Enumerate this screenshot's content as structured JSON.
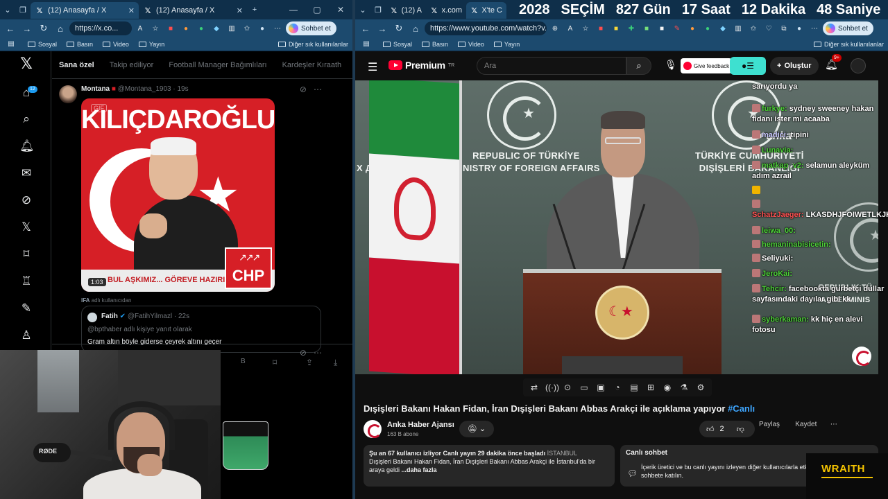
{
  "left_browser": {
    "tabs": [
      {
        "label": "(12) Anasayfa / X",
        "active": true
      },
      {
        "label": "(12) Anasayfa / X",
        "active": false
      }
    ],
    "url": "https://x.co...",
    "sohbet_label": "Sohbet et",
    "bookmarks": [
      "Sosyal",
      "Basın",
      "Video",
      "Yayın"
    ],
    "bookmarks_right": "Diğer sık kullanılanlar"
  },
  "x_app": {
    "notification_count": "12",
    "tabs": [
      "Sana özel",
      "Takip ediliyor",
      "Football Manager Bağımlıları",
      "Kardeşler Kıraath"
    ],
    "post": {
      "author": "Montana",
      "handle": "@Montana_1903",
      "time": "19s",
      "poster_title": "KILIÇDAROĞLU",
      "poster_slogan": "BUL AŞKIMIZ... GÖREVE HAZIRIZ!",
      "poster_party": "CHP",
      "media_tag": "GIF",
      "video_duration": "1:03",
      "caption_prefix": "IFA",
      "caption_suffix": "adlı kullanıcıdan"
    },
    "quote": {
      "author": "Fatih",
      "handle": "@FatihYilmazl",
      "time": "22s",
      "reply_to": "@bpthaber adlı kişiye yanıt olarak",
      "text": "Gram altın böyle giderse çeyrek altını geçer"
    },
    "actions_count": "B"
  },
  "webcam": {
    "mic_brand": "RØDE"
  },
  "right_browser": {
    "tabs": [
      {
        "label": "(12) A",
        "active": false
      },
      {
        "label": "x.com",
        "active": false
      },
      {
        "label": "X'te C",
        "active": true
      }
    ],
    "countdown": [
      "2028",
      "SEÇİM",
      "827 Gün",
      "17 Saat",
      "12 Dakika",
      "48 Saniye"
    ],
    "url": "https://www.youtube.com/watch?v...",
    "sohbet_label": "Sohbet et",
    "bookmarks": [
      "Sosyal",
      "Basın",
      "Video",
      "Yayın"
    ],
    "bookmarks_right": "Diğer sık kullanılanlar"
  },
  "youtube": {
    "logo": "Premium",
    "logo_region": "TR",
    "search_placeholder": "Ara",
    "feedback_label": "Give feedback",
    "create_label": "Oluştur",
    "notification_count": "9+",
    "wall_left": [
      "REPUBLIC OF TÜRKİYE",
      "MINISTRY OF FOREIGN AFFAIRS"
    ],
    "wall_right": [
      "TÜRKİYE CUMHURİYETİ",
      "DIŞİŞLERİ BAKANLIĞI"
    ],
    "wall_left_partial": "Х ДЕЛ",
    "wall_far_right": [
      "REPUBLIK TÜ",
      "AUßENMINIS"
    ],
    "watermark": "anka",
    "title": "Dışişleri Bakanı Hakan Fidan, İran Dışişleri Bakanı Abbas Arakçi ile açıklama yapıyor",
    "title_tag": "#Canlı",
    "channel": "Anka Haber Ajansı",
    "subscribers": "163 B abone",
    "likes": "2",
    "share_label": "Paylaş",
    "save_label": "Kaydet",
    "description": {
      "meta": "Şu an 67 kullanıcı izliyor  Canlı yayın 29 dakika önce başladı",
      "location": "İSTANBUL",
      "text": "Dışişleri Bakanı Hakan Fidan, İran Dışişleri Bakanı Abbas Arakçi ile İstanbul'da bir araya geldi",
      "more": "...daha fazla"
    },
    "live_chat": {
      "heading": "Canlı sohbet",
      "text": "İçerik üretici ve bu canlı yayını izleyen diğer kullanıcılarla etkileşime girmek için sohbete katılın."
    },
    "sponsor": "WRAITH"
  },
  "stream_chat": [
    {
      "user": "",
      "text": "sarıyordu ya",
      "color": "#ffffff"
    },
    {
      "user": "furkye:",
      "text": "sydney sweeney hakan fidanı ister mi acaaba",
      "color": "#4cd137"
    },
    {
      "user": "madici:",
      "text": "tipini",
      "color": "#c9c9ff"
    },
    {
      "user": "Lunavia:",
      "text": "",
      "color": "#4cd137"
    },
    {
      "user": "matkap_v2:",
      "text": "selamun aleyküm adım azrail",
      "color": "#4cd137"
    },
    {
      "user": "",
      "text": "",
      "color": "#ffffff"
    },
    {
      "user": "SchatzJaeger:",
      "text": "LKASDHJFOIWETLKJHLSKDGAS",
      "color": "#ff5252"
    },
    {
      "user": "leiwa_00:",
      "text": "",
      "color": "#4cd137"
    },
    {
      "user": "hemaninabisicetin:",
      "text": "",
      "color": "#4cd137"
    },
    {
      "user": "Seliyuki:",
      "text": "",
      "color": "#ffffff"
    },
    {
      "user": "JeroKai:",
      "text": "",
      "color": "#4cd137"
    },
    {
      "user": "Tehcir:",
      "text": "facebookta gurbetçi dullar sayfasındaki dayılar gibi kk",
      "color": "#4cd137"
    },
    {
      "user": "syberkaman:",
      "text": "kk hiç en alevi fotosu",
      "color": "#4cd137"
    }
  ],
  "colors": {
    "tab_bar": "#0f2f4a",
    "address_bar": "#1c4a6e",
    "x_blue": "#1d9bf0",
    "yt_red": "#ff0033",
    "chp_red": "#d61f26"
  }
}
